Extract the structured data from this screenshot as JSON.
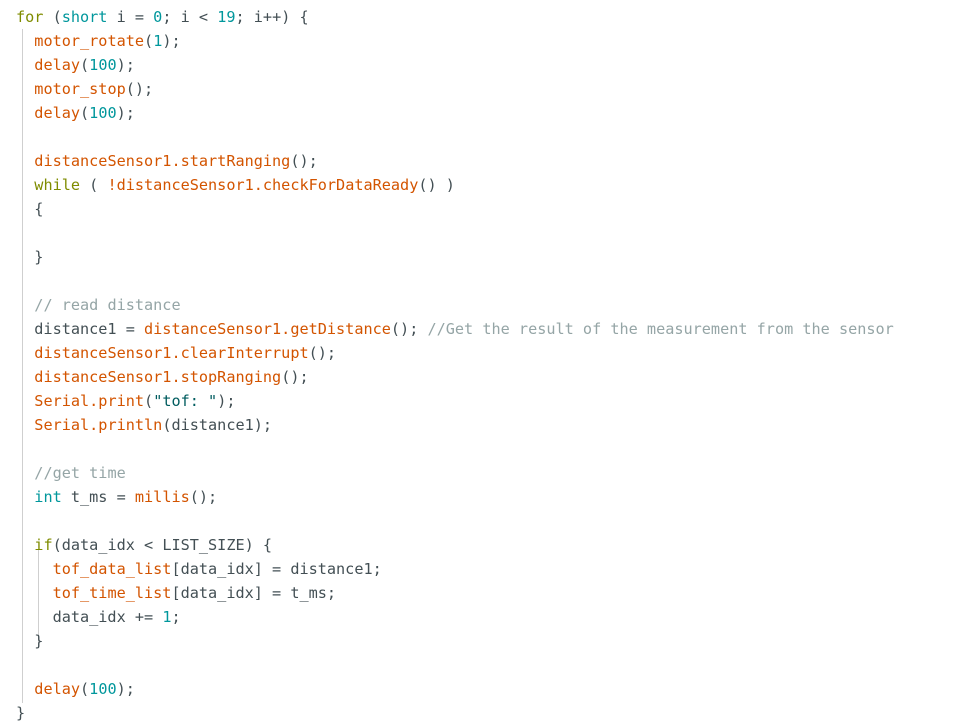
{
  "editor": {
    "name": "arduino-code-editor",
    "language": "C++ / Arduino",
    "background_color": "#ffffff",
    "font_size_px": 15,
    "line_height_px": 24,
    "colors": {
      "keyword": "#7f8c00",
      "type": "#00979c",
      "number": "#00979c",
      "function": "#d35400",
      "string": "#005c5f",
      "comment": "#95a5a6",
      "plain": "#434f54",
      "indent_guide": "#cfcfcf"
    }
  },
  "lines": [
    {
      "n": 1,
      "indent": 0,
      "text": "for (short i = 0; i < 19; i++) {"
    },
    {
      "n": 2,
      "indent": 1,
      "text": "motor_rotate(1);"
    },
    {
      "n": 3,
      "indent": 1,
      "text": "delay(100);"
    },
    {
      "n": 4,
      "indent": 1,
      "text": "motor_stop();"
    },
    {
      "n": 5,
      "indent": 1,
      "text": "delay(100);"
    },
    {
      "n": 6,
      "indent": 0,
      "text": ""
    },
    {
      "n": 7,
      "indent": 1,
      "text": "distanceSensor1.startRanging();"
    },
    {
      "n": 8,
      "indent": 1,
      "text": "while ( !distanceSensor1.checkForDataReady() )"
    },
    {
      "n": 9,
      "indent": 1,
      "text": "{"
    },
    {
      "n": 10,
      "indent": 0,
      "text": ""
    },
    {
      "n": 11,
      "indent": 1,
      "text": "}"
    },
    {
      "n": 12,
      "indent": 0,
      "text": ""
    },
    {
      "n": 13,
      "indent": 1,
      "text": "// read distance"
    },
    {
      "n": 14,
      "indent": 1,
      "text": "distance1 = distanceSensor1.getDistance(); //Get the result of the measurement from the sensor"
    },
    {
      "n": 15,
      "indent": 1,
      "text": "distanceSensor1.clearInterrupt();"
    },
    {
      "n": 16,
      "indent": 1,
      "text": "distanceSensor1.stopRanging();"
    },
    {
      "n": 17,
      "indent": 1,
      "text": "Serial.print(\"tof: \");"
    },
    {
      "n": 18,
      "indent": 1,
      "text": "Serial.println(distance1);"
    },
    {
      "n": 19,
      "indent": 0,
      "text": ""
    },
    {
      "n": 20,
      "indent": 1,
      "text": "//get time"
    },
    {
      "n": 21,
      "indent": 1,
      "text": "int t_ms = millis();"
    },
    {
      "n": 22,
      "indent": 0,
      "text": ""
    },
    {
      "n": 23,
      "indent": 1,
      "text": "if(data_idx < LIST_SIZE) {"
    },
    {
      "n": 24,
      "indent": 2,
      "text": "tof_data_list[data_idx] = distance1;"
    },
    {
      "n": 25,
      "indent": 2,
      "text": "tof_time_list[data_idx] = t_ms;"
    },
    {
      "n": 26,
      "indent": 2,
      "text": "data_idx += 1;"
    },
    {
      "n": 27,
      "indent": 1,
      "text": "}"
    },
    {
      "n": 28,
      "indent": 0,
      "text": ""
    },
    {
      "n": 29,
      "indent": 1,
      "text": "delay(100);"
    },
    {
      "n": 30,
      "indent": 0,
      "text": "}"
    }
  ],
  "tokens": {
    "line1": [
      [
        "for",
        "kw"
      ],
      [
        " (",
        "plain"
      ],
      [
        "short",
        "type"
      ],
      [
        " i = ",
        "plain"
      ],
      [
        "0",
        "num"
      ],
      [
        "; i < ",
        "plain"
      ],
      [
        "19",
        "num"
      ],
      [
        "; i++) {",
        "plain"
      ]
    ],
    "line2": [
      [
        "  ",
        "plain"
      ],
      [
        "motor_rotate",
        "fn"
      ],
      [
        "(",
        "plain"
      ],
      [
        "1",
        "num"
      ],
      [
        ");",
        "plain"
      ]
    ],
    "line3": [
      [
        "  ",
        "plain"
      ],
      [
        "delay",
        "fn"
      ],
      [
        "(",
        "plain"
      ],
      [
        "100",
        "num"
      ],
      [
        ");",
        "plain"
      ]
    ],
    "line4": [
      [
        "  ",
        "plain"
      ],
      [
        "motor_stop",
        "fn"
      ],
      [
        "();",
        "plain"
      ]
    ],
    "line5": [
      [
        "  ",
        "plain"
      ],
      [
        "delay",
        "fn"
      ],
      [
        "(",
        "plain"
      ],
      [
        "100",
        "num"
      ],
      [
        ");",
        "plain"
      ]
    ],
    "line7": [
      [
        "  ",
        "plain"
      ],
      [
        "distanceSensor1.startRanging",
        "fn"
      ],
      [
        "();",
        "plain"
      ]
    ],
    "line8": [
      [
        "  ",
        "plain"
      ],
      [
        "while",
        "kw"
      ],
      [
        " ( ",
        "plain"
      ],
      [
        "!distanceSensor1.checkForDataReady",
        "fn"
      ],
      [
        "() )",
        "plain"
      ]
    ],
    "line9": [
      [
        "  {",
        "plain"
      ]
    ],
    "line11": [
      [
        "  }",
        "plain"
      ]
    ],
    "line13": [
      [
        "  ",
        "plain"
      ],
      [
        "// read distance",
        "comment"
      ]
    ],
    "line14": [
      [
        "  distance1 = ",
        "plain"
      ],
      [
        "distanceSensor1.getDistance",
        "fn"
      ],
      [
        "(); ",
        "plain"
      ],
      [
        "//Get the result of the measurement from the sensor",
        "comment"
      ]
    ],
    "line15": [
      [
        "  ",
        "plain"
      ],
      [
        "distanceSensor1.clearInterrupt",
        "fn"
      ],
      [
        "();",
        "plain"
      ]
    ],
    "line16": [
      [
        "  ",
        "plain"
      ],
      [
        "distanceSensor1.stopRanging",
        "fn"
      ],
      [
        "();",
        "plain"
      ]
    ],
    "line17": [
      [
        "  ",
        "plain"
      ],
      [
        "Serial.print",
        "fn"
      ],
      [
        "(",
        "plain"
      ],
      [
        "\"tof: \"",
        "str"
      ],
      [
        ");",
        "plain"
      ]
    ],
    "line18": [
      [
        "  ",
        "plain"
      ],
      [
        "Serial.println",
        "fn"
      ],
      [
        "(distance1);",
        "plain"
      ]
    ],
    "line20": [
      [
        "  ",
        "plain"
      ],
      [
        "//get time",
        "comment"
      ]
    ],
    "line21": [
      [
        "  ",
        "plain"
      ],
      [
        "int",
        "type"
      ],
      [
        " t_ms = ",
        "plain"
      ],
      [
        "millis",
        "fn"
      ],
      [
        "();",
        "plain"
      ]
    ],
    "line23": [
      [
        "  ",
        "plain"
      ],
      [
        "if",
        "kw"
      ],
      [
        "(data_idx < LIST_SIZE) {",
        "plain"
      ]
    ],
    "line24": [
      [
        "    ",
        "plain"
      ],
      [
        "tof_data_list",
        "fn"
      ],
      [
        "[data_idx] = distance1;",
        "plain"
      ]
    ],
    "line25": [
      [
        "    ",
        "plain"
      ],
      [
        "tof_time_list",
        "fn"
      ],
      [
        "[data_idx] = t_ms;",
        "plain"
      ]
    ],
    "line26": [
      [
        "    data_idx += ",
        "plain"
      ],
      [
        "1",
        "num"
      ],
      [
        ";",
        "plain"
      ]
    ],
    "line27": [
      [
        "  }",
        "plain"
      ]
    ],
    "line29": [
      [
        "  ",
        "plain"
      ],
      [
        "delay",
        "fn"
      ],
      [
        "(",
        "plain"
      ],
      [
        "100",
        "num"
      ],
      [
        ");",
        "plain"
      ]
    ],
    "line30": [
      [
        "}",
        "plain"
      ]
    ]
  }
}
